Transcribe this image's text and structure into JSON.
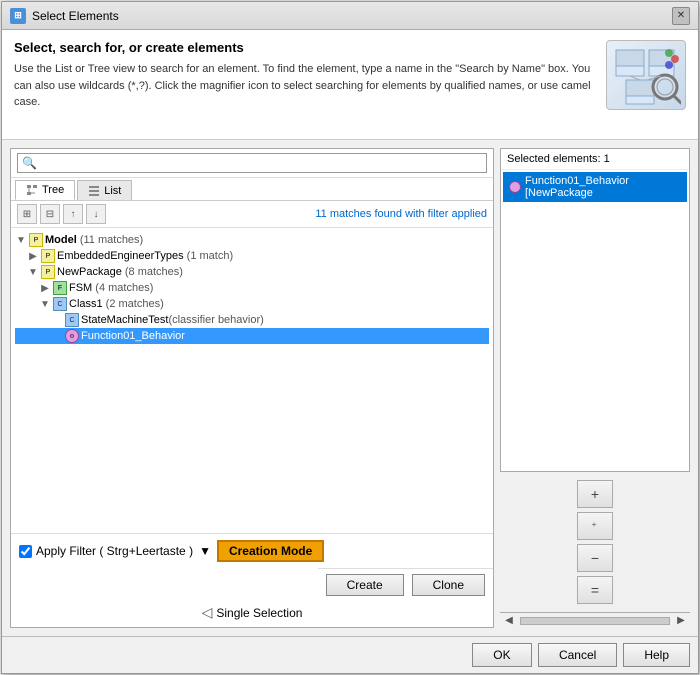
{
  "dialog": {
    "title": "Select Elements",
    "close_label": "✕"
  },
  "header": {
    "title": "Select, search for, or create elements",
    "description": "Use the List or Tree view to search for an element. To find the element, type a name in the \"Search by Name\" box. You can also use wildcards (*,?). Click the magnifier icon to select searching for elements by qualified names, or use camel case."
  },
  "search": {
    "placeholder": ""
  },
  "tabs": [
    {
      "label": "Tree",
      "active": true
    },
    {
      "label": "List",
      "active": false
    }
  ],
  "toolbar": {
    "filter_text": "11 matches found",
    "filter_suffix": "with filter applied"
  },
  "tree": {
    "items": [
      {
        "id": "model",
        "level": 0,
        "expand": "▼",
        "icon": "package",
        "label": "Model",
        "match": " (11 matches)",
        "selected": false
      },
      {
        "id": "embedded",
        "level": 1,
        "expand": "▶",
        "icon": "package",
        "label": "EmbeddedEngineerTypes",
        "match": " (1 match)",
        "selected": false
      },
      {
        "id": "newpackage",
        "level": 1,
        "expand": "▼",
        "icon": "package",
        "label": "NewPackage",
        "match": " (8 matches)",
        "selected": false
      },
      {
        "id": "fsm",
        "level": 2,
        "expand": "▶",
        "icon": "fsm",
        "label": "FSM",
        "match": " (4 matches)",
        "selected": false
      },
      {
        "id": "class1",
        "level": 2,
        "expand": "▼",
        "icon": "class",
        "label": "Class1",
        "match": " (2 matches)",
        "selected": false
      },
      {
        "id": "statemachinetest",
        "level": 3,
        "expand": " ",
        "icon": "class",
        "label": "StateMachineTest",
        "match": "(classifier behavior)",
        "selected": false
      },
      {
        "id": "function01",
        "level": 3,
        "expand": " ",
        "icon": "behavior",
        "label": "Function01_Behavior",
        "match": "",
        "selected": true
      }
    ]
  },
  "bottom": {
    "apply_filter_label": "Apply Filter ( Strg+Leertaste )",
    "creation_mode_label": "Creation Mode",
    "create_label": "Create",
    "clone_label": "Clone",
    "selection_label": "Single Selection"
  },
  "right_panel": {
    "header": "Selected elements: 1",
    "selected_item": "Function01_Behavior [NewPackage"
  },
  "action_buttons": [
    {
      "id": "add",
      "label": "+"
    },
    {
      "id": "add-alt",
      "label": "+"
    },
    {
      "id": "remove",
      "label": "−"
    },
    {
      "id": "equals",
      "label": "="
    }
  ],
  "footer": {
    "ok_label": "OK",
    "cancel_label": "Cancel",
    "help_label": "Help"
  }
}
